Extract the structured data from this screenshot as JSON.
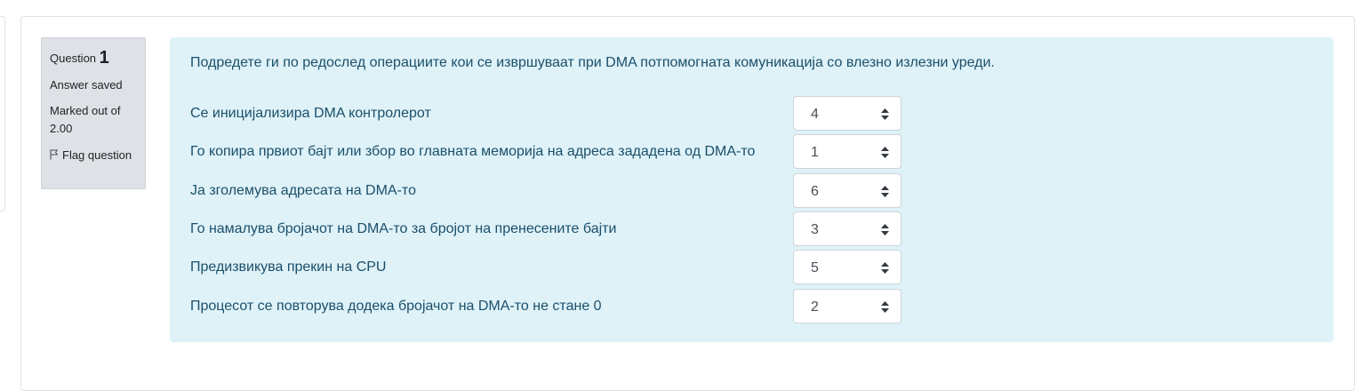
{
  "question_info": {
    "label": "Question",
    "number": "1",
    "state": "Answer saved",
    "grade": "Marked out of 2.00",
    "flag_label": "Flag question"
  },
  "question": {
    "text": "Подредете ги по редослед операциите кои се извршуваат при DMA потпомогната комуникација со влезно излезни уреди.",
    "rows": [
      {
        "label": "Се иницијализира DMA контролерот",
        "value": "4"
      },
      {
        "label": "Го копира првиот бајт или збор во главната меморија на адреса зададена од DMA-то",
        "value": "1"
      },
      {
        "label": "Ја зголемува адресата на DMA-то",
        "value": "6"
      },
      {
        "label": "Го намалува бројачот на DMA-то за бројот на пренесените бајти",
        "value": "3"
      },
      {
        "label": "Предизвикува прекин на CPU",
        "value": "5"
      },
      {
        "label": "Процесот се повторува додека бројачот на DMA-то не стане 0",
        "value": "2"
      }
    ]
  },
  "colors": {
    "info_bg": "#dee2e6",
    "formulation_bg": "#def2f8",
    "question_text": "#1b4f6b"
  },
  "icons": {
    "flag": "flag-outline-icon",
    "select_arrows": "sort-arrows-icon"
  }
}
